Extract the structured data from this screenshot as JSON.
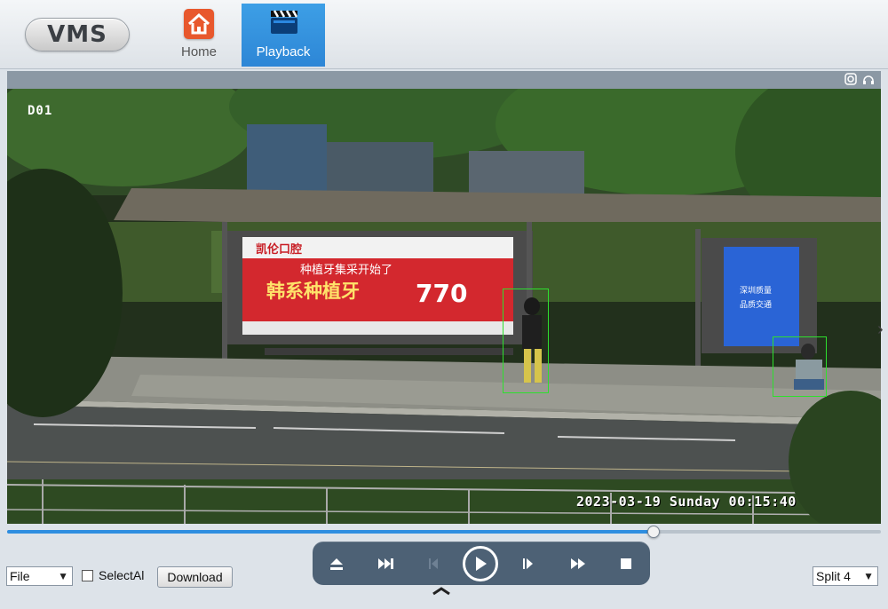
{
  "header": {
    "logo": "VMS",
    "tabs": [
      {
        "label": "Home",
        "icon": "home-icon",
        "active": false
      },
      {
        "label": "Playback",
        "icon": "film-clapper-icon",
        "active": true
      }
    ]
  },
  "video": {
    "channel": "D01",
    "osd_timestamp": "2023-03-19 Sunday 00:15:40",
    "toolbar_icons": [
      "snapshot-icon",
      "audio-icon"
    ],
    "detections": 2
  },
  "timeline": {
    "progress": 0.74,
    "accent": "#2e8ee0"
  },
  "bottom": {
    "file_select": "File",
    "select_all_label": "SelectAl",
    "download_label": "Download",
    "split_select": "Split 4"
  },
  "controls": [
    "eject-icon",
    "fast-forward-icon",
    "step-back-icon",
    "play-icon",
    "step-forward-icon",
    "speed-up-icon",
    "stop-icon"
  ]
}
